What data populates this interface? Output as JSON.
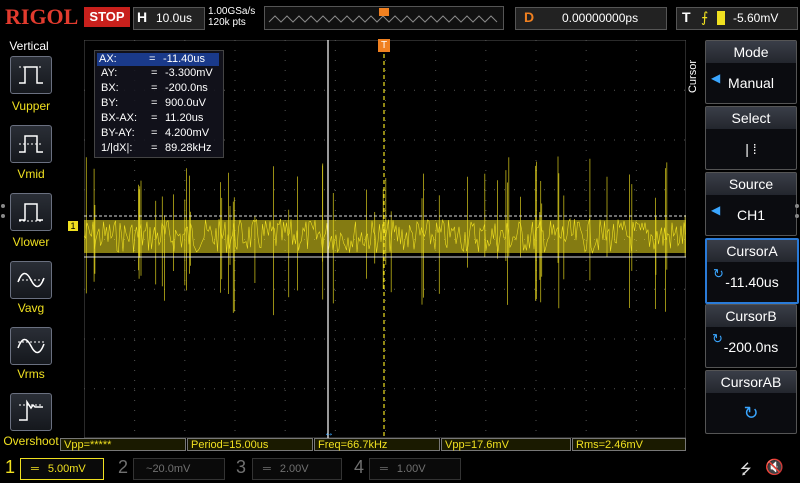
{
  "brand": {
    "logo": "RIGOL",
    "run_state": "STOP"
  },
  "timebase": {
    "key": "H",
    "value": "10.0us",
    "sample_rate": "1.00GSa/s",
    "points": "120k pts"
  },
  "delay": {
    "key": "D",
    "value": "0.00000000ps"
  },
  "trigger": {
    "key": "T",
    "level": "-5.60mV"
  },
  "left_menu": {
    "title": "Vertical",
    "items": [
      {
        "label": "Vupper"
      },
      {
        "label": "Vmid"
      },
      {
        "label": "Vlower"
      },
      {
        "label": "Vavg"
      },
      {
        "label": "Vrms"
      },
      {
        "label": "Overshoot"
      }
    ]
  },
  "cursor_readout": [
    {
      "name": "AX:",
      "eq": "=",
      "value": "-11.40us"
    },
    {
      "name": "AY:",
      "eq": "=",
      "value": "-3.300mV"
    },
    {
      "name": "BX:",
      "eq": "=",
      "value": "-200.0ns"
    },
    {
      "name": "BY:",
      "eq": "=",
      "value": "900.0uV"
    },
    {
      "name": "BX-AX:",
      "eq": "=",
      "value": "11.20us"
    },
    {
      "name": "BY-AY:",
      "eq": "=",
      "value": "4.200mV"
    },
    {
      "name": "1/|dX|:",
      "eq": "=",
      "value": "89.28kHz"
    }
  ],
  "right_menu": {
    "side_label": "Cursor",
    "mode": {
      "title": "Mode",
      "value": "Manual"
    },
    "select": {
      "title": "Select",
      "value": "|   ⁞"
    },
    "source": {
      "title": "Source",
      "value": "CH1"
    },
    "cursor_a": {
      "title": "CursorA",
      "value": "-11.40us"
    },
    "cursor_b": {
      "title": "CursorB",
      "value": "-200.0ns"
    },
    "cursor_ab": {
      "title": "CursorAB",
      "value": ""
    }
  },
  "measurements": [
    {
      "label": "Vpp=*****"
    },
    {
      "label": "Period=15.00us"
    },
    {
      "label": "Freq=66.7kHz"
    },
    {
      "label": "Vpp=17.6mV"
    },
    {
      "label": "Rms=2.46mV"
    }
  ],
  "channels": [
    {
      "num": "1",
      "scale": "5.00mV"
    },
    {
      "num": "2",
      "scale": "20.0mV"
    },
    {
      "num": "3",
      "scale": "2.00V"
    },
    {
      "num": "4",
      "scale": "1.00V"
    }
  ],
  "markers": {
    "ch1": "1",
    "trigger_pos": "T"
  },
  "colors": {
    "ch1": "#f0e020",
    "accent": "#f08020",
    "stop": "#c8201c",
    "highlight": "#2a7bd8"
  }
}
